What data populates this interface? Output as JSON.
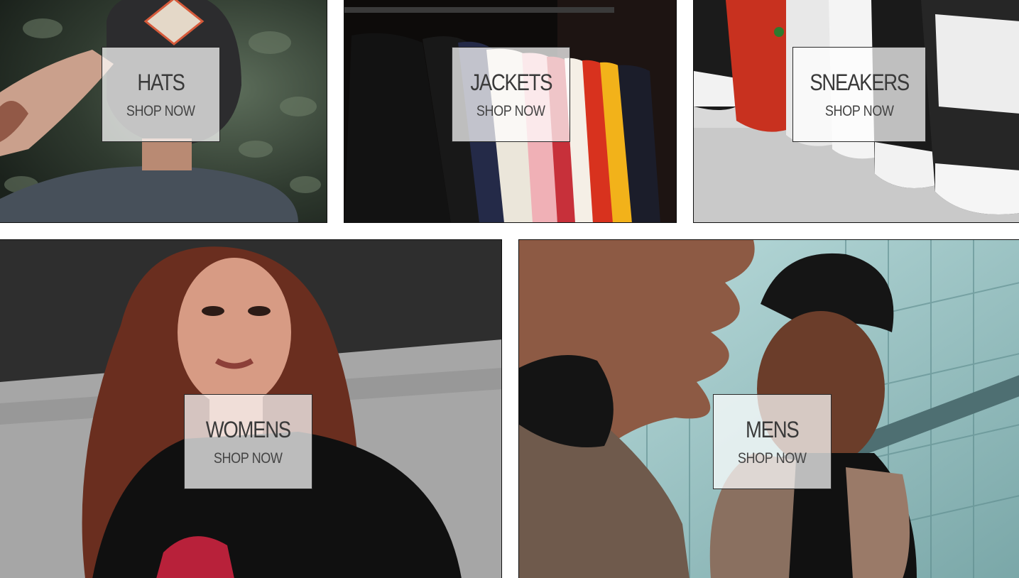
{
  "categories": {
    "hats": {
      "title": "HATS",
      "cta": "SHOP NOW"
    },
    "jackets": {
      "title": "JACKETS",
      "cta": "SHOP NOW"
    },
    "sneakers": {
      "title": "SNEAKERS",
      "cta": "SHOP NOW"
    },
    "womens": {
      "title": "WOMENS",
      "cta": "SHOP NOW"
    },
    "mens": {
      "title": "MENS",
      "cta": "SHOP NOW"
    }
  }
}
